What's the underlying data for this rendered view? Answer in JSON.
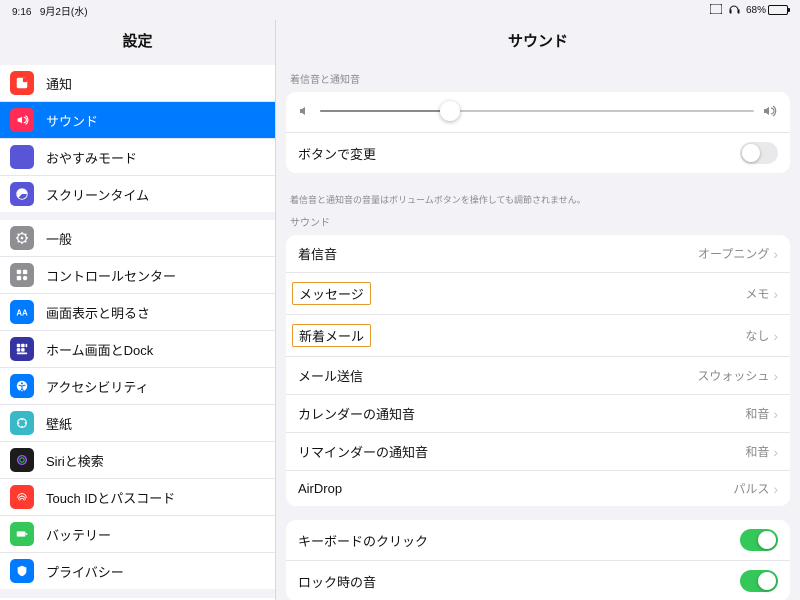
{
  "status": {
    "time": "9:16",
    "date": "9月2日(水)",
    "battery_pct": "68%",
    "battery_fill": 68
  },
  "sidebar": {
    "title": "設定",
    "items": [
      {
        "label": "通知",
        "icon": "notification-icon",
        "bg": "#ff3b30"
      },
      {
        "label": "サウンド",
        "icon": "sound-icon",
        "bg": "#ff2d55",
        "active": true
      },
      {
        "label": "おやすみモード",
        "icon": "dnd-icon",
        "bg": "#5856d6"
      },
      {
        "label": "スクリーンタイム",
        "icon": "screentime-icon",
        "bg": "#5856d6"
      }
    ],
    "items2": [
      {
        "label": "一般",
        "icon": "general-icon",
        "bg": "#8e8e93"
      },
      {
        "label": "コントロールセンター",
        "icon": "control-center-icon",
        "bg": "#8e8e93"
      },
      {
        "label": "画面表示と明るさ",
        "icon": "display-icon",
        "bg": "#007aff"
      },
      {
        "label": "ホーム画面とDock",
        "icon": "home-icon",
        "bg": "#3634a3"
      },
      {
        "label": "アクセシビリティ",
        "icon": "accessibility-icon",
        "bg": "#007aff"
      },
      {
        "label": "壁紙",
        "icon": "wallpaper-icon",
        "bg": "#38b9c7"
      },
      {
        "label": "Siriと検索",
        "icon": "siri-icon",
        "bg": "#1c1c1e"
      },
      {
        "label": "Touch IDとパスコード",
        "icon": "touchid-icon",
        "bg": "#ff3b30"
      },
      {
        "label": "バッテリー",
        "icon": "battery-icon",
        "bg": "#34c759"
      },
      {
        "label": "プライバシー",
        "icon": "privacy-icon",
        "bg": "#007aff"
      }
    ]
  },
  "main": {
    "title": "サウンド",
    "ringer_section_label": "着信音と通知音",
    "slider_pct": 30,
    "change_with_buttons": {
      "label": "ボタンで変更",
      "on": false
    },
    "footer": "着信音と通知音の音量はボリュームボタンを操作しても調節されません。",
    "sounds_section_label": "サウンド",
    "rows": [
      {
        "label": "着信音",
        "value": "オープニング",
        "highlight": false
      },
      {
        "label": "メッセージ",
        "value": "メモ",
        "highlight": true
      },
      {
        "label": "新着メール",
        "value": "なし",
        "highlight": true
      },
      {
        "label": "メール送信",
        "value": "スウォッシュ",
        "highlight": false
      },
      {
        "label": "カレンダーの通知音",
        "value": "和音",
        "highlight": false
      },
      {
        "label": "リマインダーの通知音",
        "value": "和音",
        "highlight": false
      },
      {
        "label": "AirDrop",
        "value": "パルス",
        "highlight": false
      }
    ],
    "toggles": [
      {
        "label": "キーボードのクリック",
        "on": true
      },
      {
        "label": "ロック時の音",
        "on": true
      }
    ]
  }
}
